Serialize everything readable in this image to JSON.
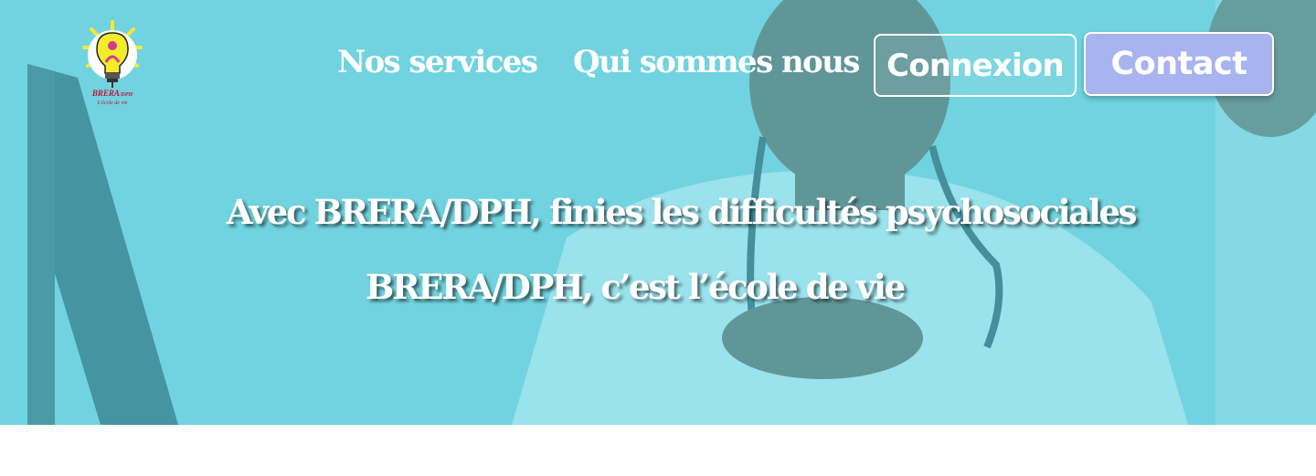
{
  "brand": {
    "logo_name": "BRERA",
    "logo_suffix": "/DPH",
    "logo_subtitle": "L'école de vie",
    "logo_icon": "lightbulb-icon"
  },
  "nav": {
    "services_label": "Nos services",
    "about_label": "Qui sommes nous",
    "connexion_label": "Connexion",
    "contact_label": "Contact"
  },
  "hero": {
    "headline": "Avec BRERA/DPH, finies les difficultés psychosociales",
    "tagline": "BRERA/DPH, c’est l’école de vie"
  },
  "colors": {
    "overlay": "#5fd9e6",
    "contact_button": "#a8b4f0",
    "text": "#ffffff",
    "logo_red": "#c0143c"
  }
}
